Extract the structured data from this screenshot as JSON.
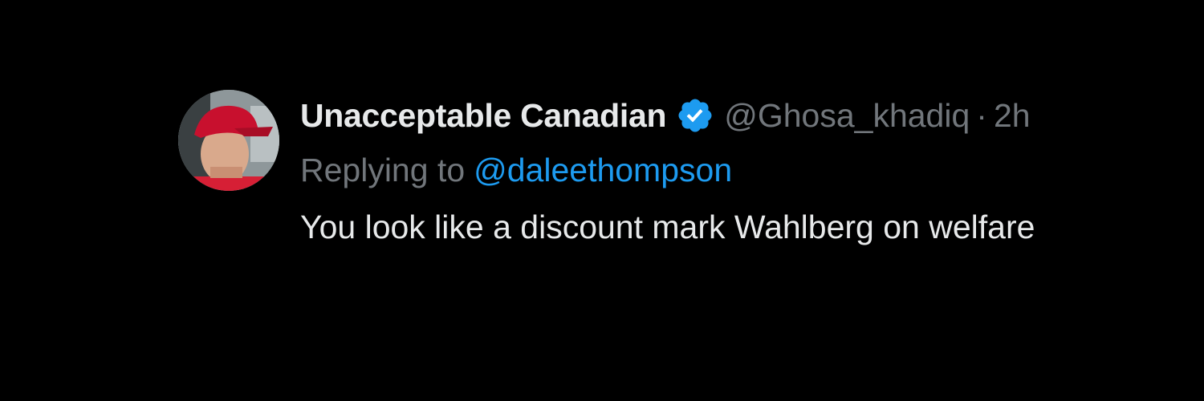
{
  "tweet": {
    "display_name": "Unacceptable Canadian",
    "verified_icon": "verified-badge-icon",
    "handle": "@Ghosa_khadiq",
    "separator": "·",
    "timestamp": "2h",
    "reply_prefix": "Replying to",
    "reply_to": "@daleethompson",
    "text": "You look like a discount mark Wahlberg on welfare"
  },
  "colors": {
    "background": "#000000",
    "primary_text": "#e7e9ea",
    "secondary_text": "#71767b",
    "accent_blue": "#1d9bf0"
  }
}
